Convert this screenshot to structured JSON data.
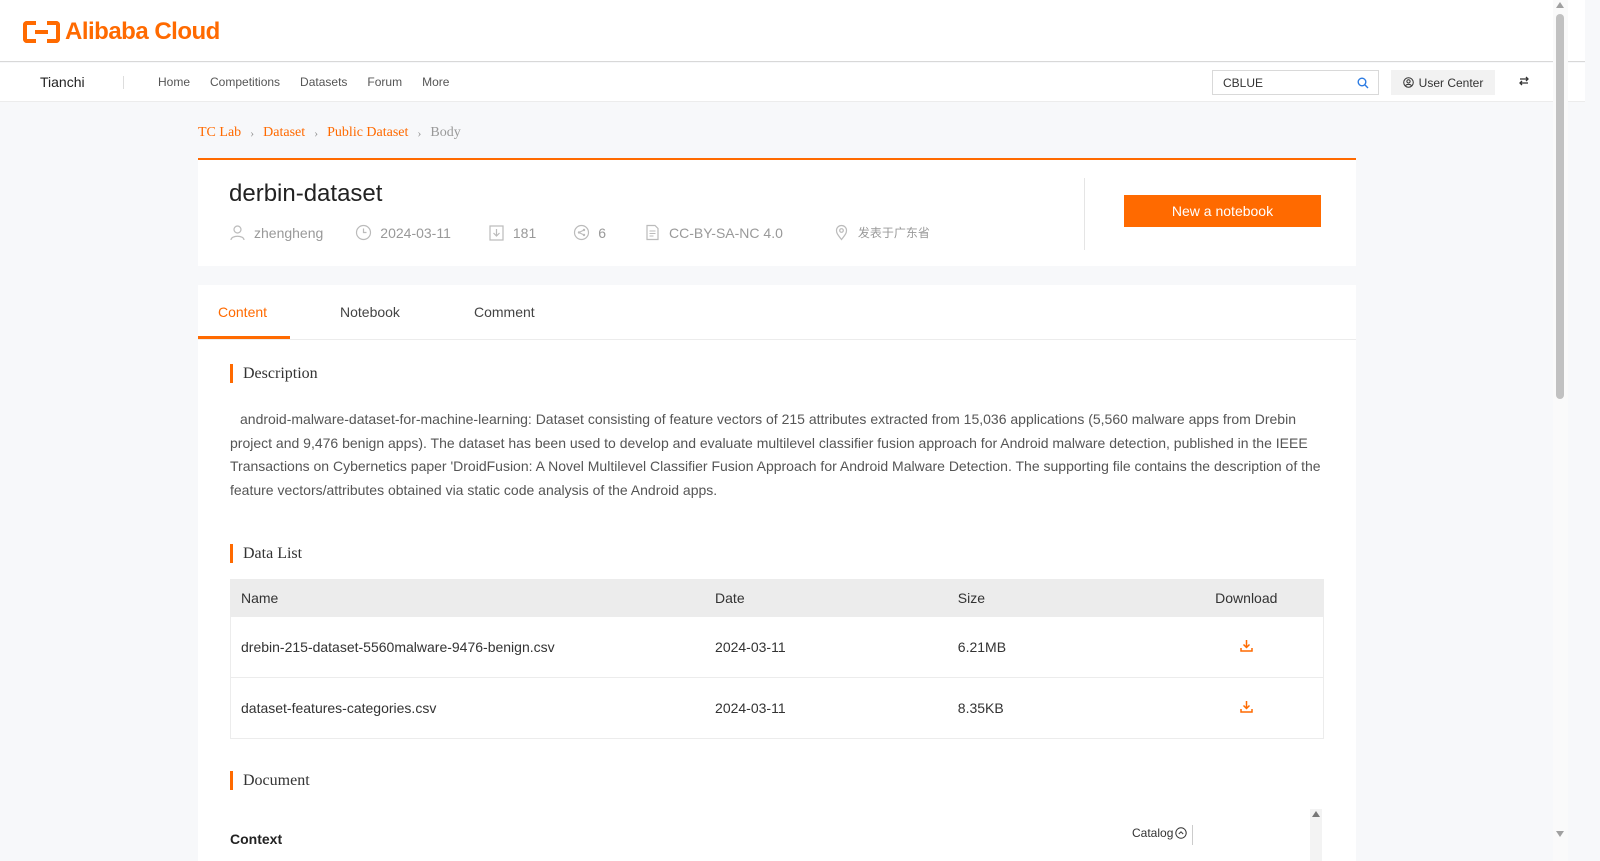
{
  "brand": {
    "logo_text": "Alibaba Cloud",
    "accent": "#ff6a00"
  },
  "nav": {
    "product": "Tianchi",
    "links": [
      "Home",
      "Competitions",
      "Datasets",
      "Forum",
      "More"
    ],
    "search_value": "CBLUE",
    "user_center": "User Center"
  },
  "breadcrumb": [
    "TC Lab",
    "Dataset",
    "Public Dataset",
    "Body"
  ],
  "dataset": {
    "title": "derbin-dataset",
    "author": "zhengheng",
    "date": "2024-03-11",
    "downloads": "181",
    "shares": "6",
    "license": "CC-BY-SA-NC 4.0",
    "location": "发表于广东省",
    "new_notebook": "New a notebook"
  },
  "tabs": [
    "Content",
    "Notebook",
    "Comment"
  ],
  "sections": {
    "description_title": "Description",
    "description": "android-malware-dataset-for-machine-learning: Dataset consisting of feature vectors of 215 attributes extracted from 15,036 applications (5,560 malware apps from Drebin project and 9,476 benign apps). The dataset has been used to develop and evaluate multilevel classifier fusion approach for Android malware detection, published in the IEEE Transactions on Cybernetics paper 'DroidFusion: A Novel Multilevel Classifier Fusion Approach for Android Malware Detection. The supporting file contains the description of the feature vectors/attributes obtained via static code analysis of the Android apps.",
    "datalist_title": "Data List",
    "document_title": "Document",
    "context": "Context",
    "catalog": "Catalog"
  },
  "table": {
    "headers": [
      "Name",
      "Date",
      "Size",
      "Download"
    ],
    "rows": [
      {
        "name": "drebin-215-dataset-5560malware-9476-benign.csv",
        "date": "2024-03-11",
        "size": "6.21MB"
      },
      {
        "name": "dataset-features-categories.csv",
        "date": "2024-03-11",
        "size": "8.35KB"
      }
    ]
  }
}
